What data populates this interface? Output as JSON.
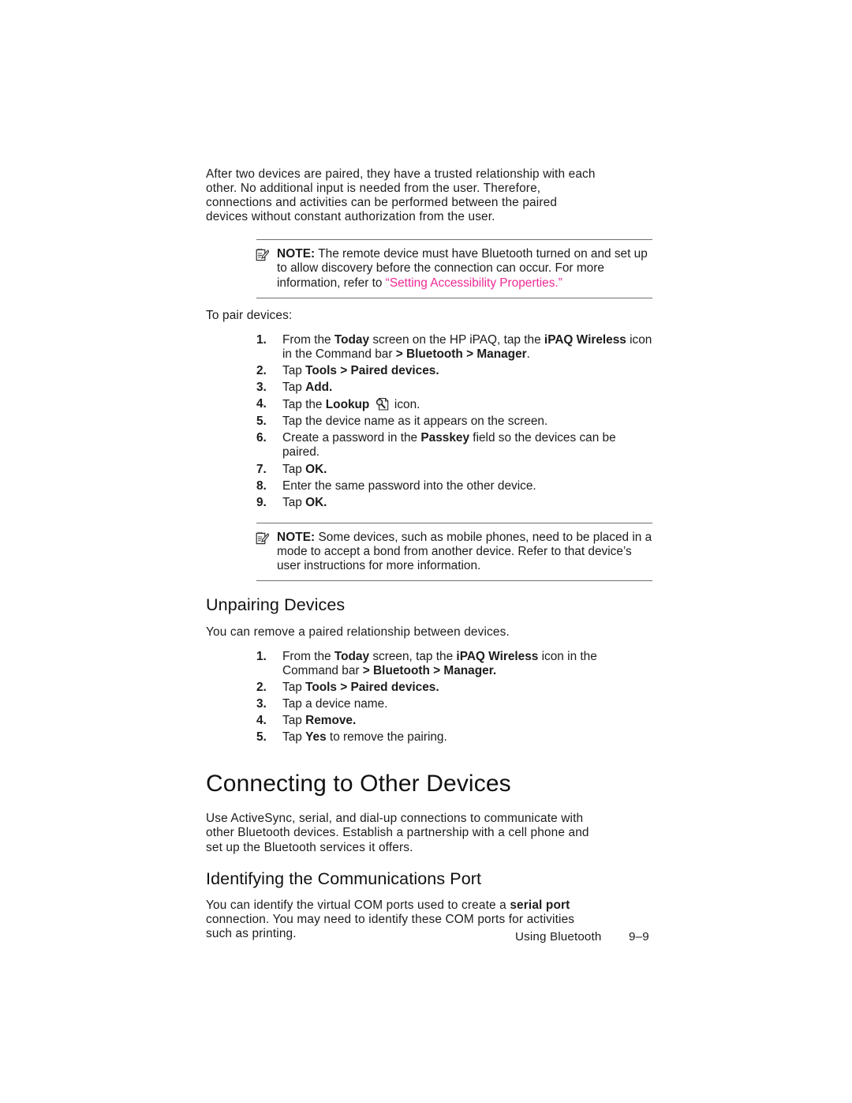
{
  "document": {
    "intro_paragraph": "After two devices are paired, they have a trusted relationship with each other. No additional input is needed from the user. Therefore, connections and activities can be performed between the paired devices without constant authorization from the user.",
    "note_1": {
      "label": "NOTE:",
      "text_before_link": "The remote device must have Bluetooth turned on and set up to allow discovery before the connection can occur. For more information, refer to ",
      "link_text": "“Setting Accessibility Properties.”",
      "icon": "note-pad-pencil-icon"
    },
    "pair_intro": "To pair devices:",
    "pair_steps": [
      {
        "num": "1.",
        "html": "From the <b>Today</b> screen on the HP iPAQ, tap the <b>iPAQ Wireless</b> icon in the Command bar <b>&gt; Bluetooth &gt; Manager</b>."
      },
      {
        "num": "2.",
        "html": "Tap <b>Tools &gt; Paired devices.</b>"
      },
      {
        "num": "3.",
        "html": "Tap <b>Add.</b>"
      },
      {
        "num": "4.",
        "html": "Tap the <b>Lookup</b> <span class=\"lookup-icon\" data-name=\"lookup-icon\" data-interactable=\"false\"><svg viewBox=\"0 0 19 18\" width=\"19\" height=\"18\"><path d=\"M5.5 1.5 h8 l3.2 3.2 v11.3 h-11.2 z\" fill=\"#ffffff\" stroke=\"#2b2b2b\" stroke-width=\"1.1\"/><path d=\"M13.5 1.5 v3.4 h3.2\" fill=\"none\" stroke=\"#2b2b2b\" stroke-width=\"1.1\"/><circle cx=\"6.1\" cy=\"6.4\" r=\"3.5\" fill=\"#e8e8e8\" stroke=\"#2b2b2b\" stroke-width=\"1.5\"/><line x1=\"8.7\" y1=\"9.1\" x2=\"13.2\" y2=\"13.9\" stroke=\"#2b2b2b\" stroke-width=\"2.1\"/></svg></span> icon."
      },
      {
        "num": "5.",
        "html": "Tap the device name as it appears on the screen."
      },
      {
        "num": "6.",
        "html": "Create a password in the <b>Passkey</b> field so the devices can be paired."
      },
      {
        "num": "7.",
        "html": "Tap <b>OK.</b>"
      },
      {
        "num": "8.",
        "html": "Enter the same password into the other device."
      },
      {
        "num": "9.",
        "html": "Tap <b>OK.</b>"
      }
    ],
    "note_2": {
      "label": "NOTE:",
      "text": "Some devices, such as mobile phones, need to be placed in a mode to accept a bond from another device. Refer to that device’s user instructions for more information.",
      "icon": "note-pad-pencil-icon"
    },
    "unpairing": {
      "heading": "Unpairing Devices",
      "intro": "You can remove a paired relationship between devices.",
      "steps": [
        {
          "num": "1.",
          "html": "From the <b>Today</b> screen, tap the <b>iPAQ Wireless</b> icon in the Command bar <b>&gt; Bluetooth &gt; Manager.</b>"
        },
        {
          "num": "2.",
          "html": "Tap <b>Tools &gt; Paired devices.</b>"
        },
        {
          "num": "3.",
          "html": "Tap a device name."
        },
        {
          "num": "4.",
          "html": "Tap <b>Remove.</b>"
        },
        {
          "num": "5.",
          "html": "Tap <b>Yes</b> to remove the pairing."
        }
      ]
    },
    "connecting": {
      "heading": "Connecting to Other Devices",
      "paragraph": "Use ActiveSync, serial, and dial-up connections to communicate with other Bluetooth devices. Establish a partnership with a cell phone and set up the Bluetooth services it offers."
    },
    "identifying": {
      "heading": "Identifying the Communications Port",
      "paragraph_html": "You can identify the virtual COM ports used to create a <b>serial port</b> connection. You may need to identify these COM ports for activities such as printing."
    },
    "footer": {
      "chapter_label": "Using Bluetooth",
      "page_number": "9–9"
    },
    "colors": {
      "link": "#ee2a95",
      "text": "#1c1c1c",
      "rule": "#6f6f6f"
    }
  }
}
